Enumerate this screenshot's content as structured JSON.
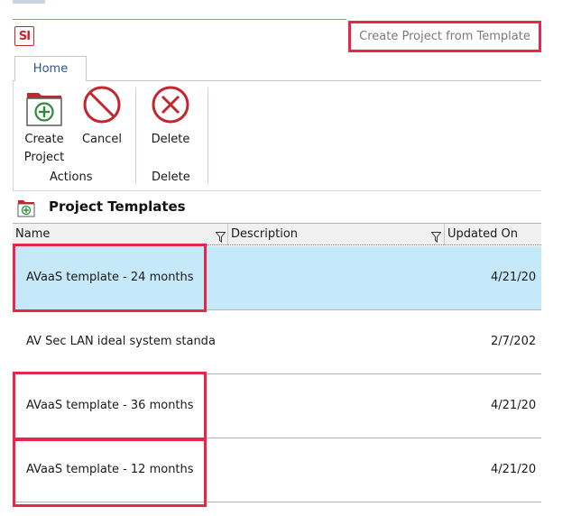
{
  "app": {
    "logo_text": "SI",
    "window_title": "Create Project from Template"
  },
  "ribbon": {
    "tabs": [
      {
        "label": "Home"
      }
    ],
    "buttons": {
      "create_project_line1": "Create",
      "create_project_line2": "Project",
      "cancel": "Cancel",
      "delete": "Delete"
    },
    "groups": {
      "actions": "Actions",
      "delete": "Delete"
    }
  },
  "section": {
    "title": "Project Templates"
  },
  "grid": {
    "columns": [
      {
        "label": "Name"
      },
      {
        "label": "Description"
      },
      {
        "label": "Updated On"
      }
    ],
    "rows": [
      {
        "name": "AVaaS template - 24 months",
        "updated_on": "4/21/20"
      },
      {
        "name": "AV Sec LAN ideal system standa",
        "updated_on": "2/7/202"
      },
      {
        "name": "AVaaS template - 36 months",
        "updated_on": "4/21/20"
      },
      {
        "name": "AVaaS template - 12 months",
        "updated_on": "4/21/20"
      }
    ]
  },
  "colors": {
    "accent": "#2b579a",
    "selection": "#c6e9f9",
    "highlight": "#e8264a",
    "icon_red": "#c4262e",
    "icon_green": "#2e8b3a"
  },
  "icons": {
    "create_project": "folder-add-icon",
    "cancel": "no-entry-icon",
    "delete": "x-circle-icon",
    "filter": "funnel-icon"
  }
}
